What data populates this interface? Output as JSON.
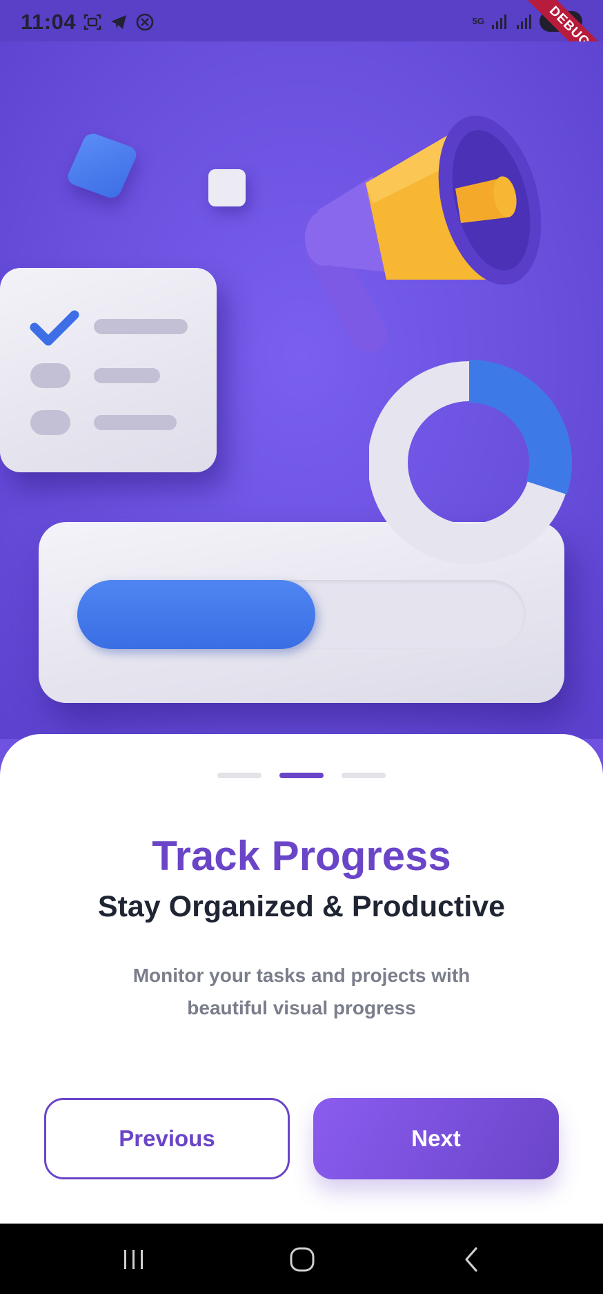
{
  "status_bar": {
    "time": "11:04",
    "left_icons": [
      "screenshot-icon",
      "telegram-icon",
      "blocked-icon"
    ],
    "network_label": "5G",
    "battery": "80",
    "debug_banner": "DEBUG"
  },
  "hero": {
    "illustration_icons": [
      "cube-icon",
      "checklist-icon",
      "megaphone-icon",
      "donut-chart-icon",
      "progress-bar-icon"
    ],
    "progress_fraction": 0.53,
    "donut_fraction": 0.3
  },
  "onboarding": {
    "page_count": 3,
    "active_page": 2,
    "title": "Track Progress",
    "subtitle": "Stay Organized & Productive",
    "description": "Monitor your tasks and projects with beautiful visual progress",
    "previous_label": "Previous",
    "next_label": "Next"
  },
  "colors": {
    "primary": "#6a45c8",
    "hero_background": "#6f52df",
    "accent_blue": "#3d6ee6",
    "accent_yellow": "#f7b733"
  },
  "navbar": {
    "icons": [
      "recent-apps-icon",
      "home-icon",
      "back-icon"
    ]
  }
}
